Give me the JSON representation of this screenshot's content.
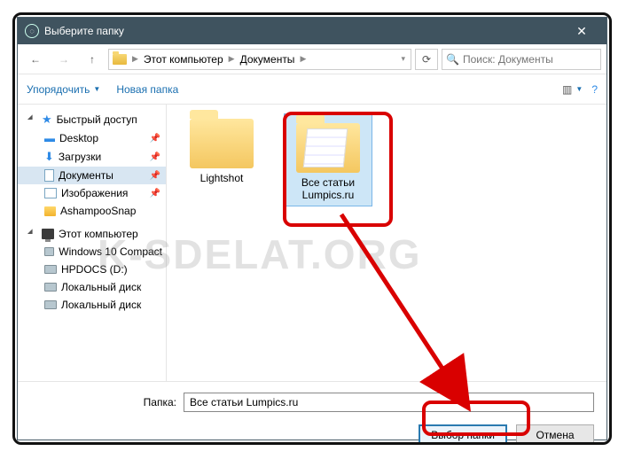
{
  "title": "Выберите папку",
  "breadcrumb": {
    "root": "Этот компьютер",
    "current": "Документы"
  },
  "search": {
    "placeholder": "Поиск: Документы"
  },
  "cmdbar": {
    "organize": "Упорядочить",
    "newfolder": "Новая папка"
  },
  "sidebar": {
    "quick": {
      "label": "Быстрый доступ",
      "items": [
        {
          "label": "Desktop",
          "pinned": true
        },
        {
          "label": "Загрузки",
          "pinned": true
        },
        {
          "label": "Документы",
          "pinned": true,
          "selected": true
        },
        {
          "label": "Изображения",
          "pinned": true
        },
        {
          "label": "AshampooSnap",
          "pinned": false
        }
      ]
    },
    "thispc": {
      "label": "Этот компьютер",
      "items": [
        {
          "label": "Windows 10 Compact"
        },
        {
          "label": "HPDOCS (D:)"
        },
        {
          "label": "Локальный диск"
        },
        {
          "label": "Локальный диск"
        }
      ]
    }
  },
  "content": {
    "items": [
      {
        "label": "Lightshot",
        "selected": false
      },
      {
        "label": "Все статьи Lumpics.ru",
        "selected": true
      }
    ]
  },
  "footer": {
    "field_label": "Папка:",
    "field_value": "Все статьи Lumpics.ru",
    "primary": "Выбор папки",
    "cancel": "Отмена"
  },
  "watermark": "K-SDELAT.ORG"
}
